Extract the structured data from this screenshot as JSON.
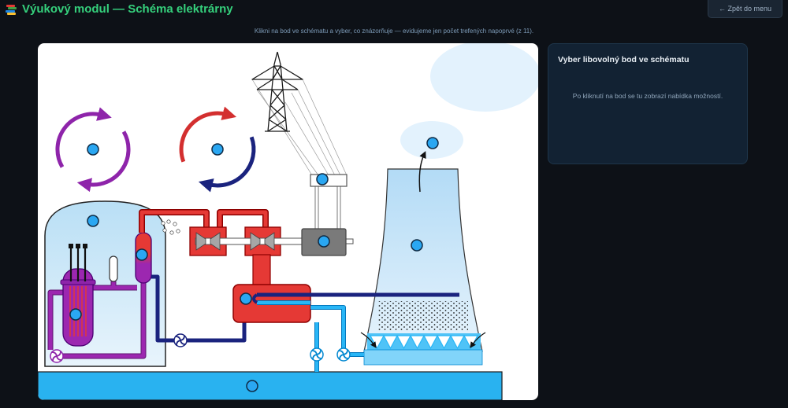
{
  "header": {
    "icon": "books-icon",
    "title": "Výukový modul — Schéma elektrárny",
    "back_button_label": "← Zpět do menu"
  },
  "instructions": "Klikni na bod ve schématu a vyber, co znázorňuje — evidujeme jen počet trefených napoprvé (z 11).",
  "side_panel": {
    "heading": "Vyber libovolný bod ve schématu",
    "hint": "Po kliknutí na bod se tu zobrazí nabídka možností."
  },
  "colors": {
    "page_background": "#0d1117",
    "title": "#35d07c",
    "side_panel_background": "#122233",
    "hotspot": "#2aa7f2",
    "primary_circuit": "#9c27b0",
    "steam_circuit": "#e53935",
    "feedwater_circuit": "#1a237e",
    "cooling_water": "#29b6f6"
  }
}
